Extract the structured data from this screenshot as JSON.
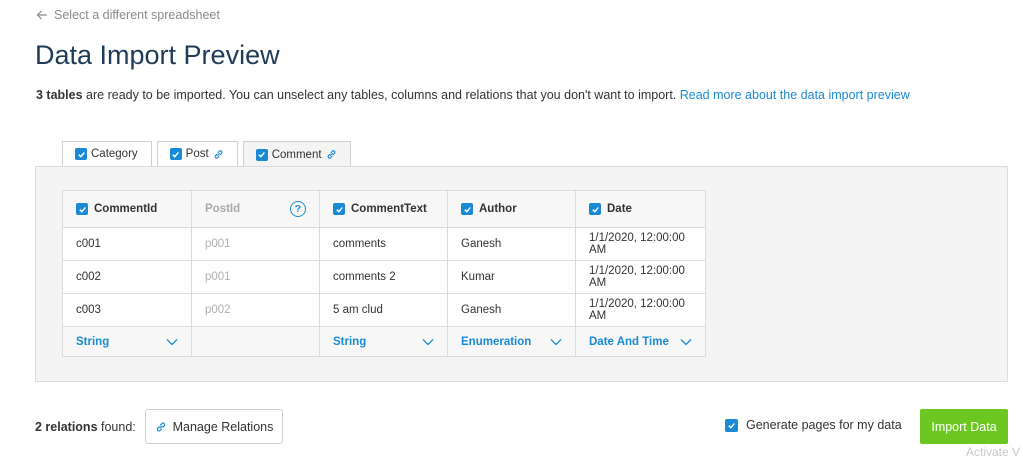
{
  "back_link": {
    "label": "Select a different spreadsheet"
  },
  "page_title": "Data Import Preview",
  "intro": {
    "count_bold": "3 tables",
    "text": " are ready to be imported. You can unselect any tables, columns and relations that you don't want to import. ",
    "link": "Read more about the data import preview"
  },
  "tabs": [
    {
      "label": "Category",
      "checked": true,
      "has_link_icon": false
    },
    {
      "label": "Post",
      "checked": true,
      "has_link_icon": true
    },
    {
      "label": "Comment",
      "checked": true,
      "has_link_icon": true,
      "active": true
    }
  ],
  "table": {
    "columns": [
      {
        "label": "CommentId",
        "checked": true
      },
      {
        "label": "PostId",
        "checked": false,
        "help": "?"
      },
      {
        "label": "CommentText",
        "checked": true
      },
      {
        "label": "Author",
        "checked": true
      },
      {
        "label": "Date",
        "checked": true
      }
    ],
    "rows": [
      [
        "c001",
        "p001",
        "comments",
        "Ganesh",
        "1/1/2020, 12:00:00 AM"
      ],
      [
        "c002",
        "p001",
        "comments 2",
        "Kumar",
        "1/1/2020, 12:00:00 AM"
      ],
      [
        "c003",
        "p002",
        "5 am clud",
        "Ganesh",
        "1/1/2020, 12:00:00 AM"
      ]
    ],
    "types": [
      "String",
      "",
      "String",
      "Enumeration",
      "Date And Time"
    ]
  },
  "relations": {
    "count_bold": "2 relations",
    "suffix": " found:",
    "manage_label": "Manage Relations"
  },
  "generate_pages": {
    "label": "Generate pages for my data",
    "checked": true
  },
  "import_button": {
    "label": "Import Data"
  },
  "watermark": "Activate V",
  "colors": {
    "accent": "#1a8ad4",
    "title": "#1f3b57",
    "import": "#6dc721"
  }
}
